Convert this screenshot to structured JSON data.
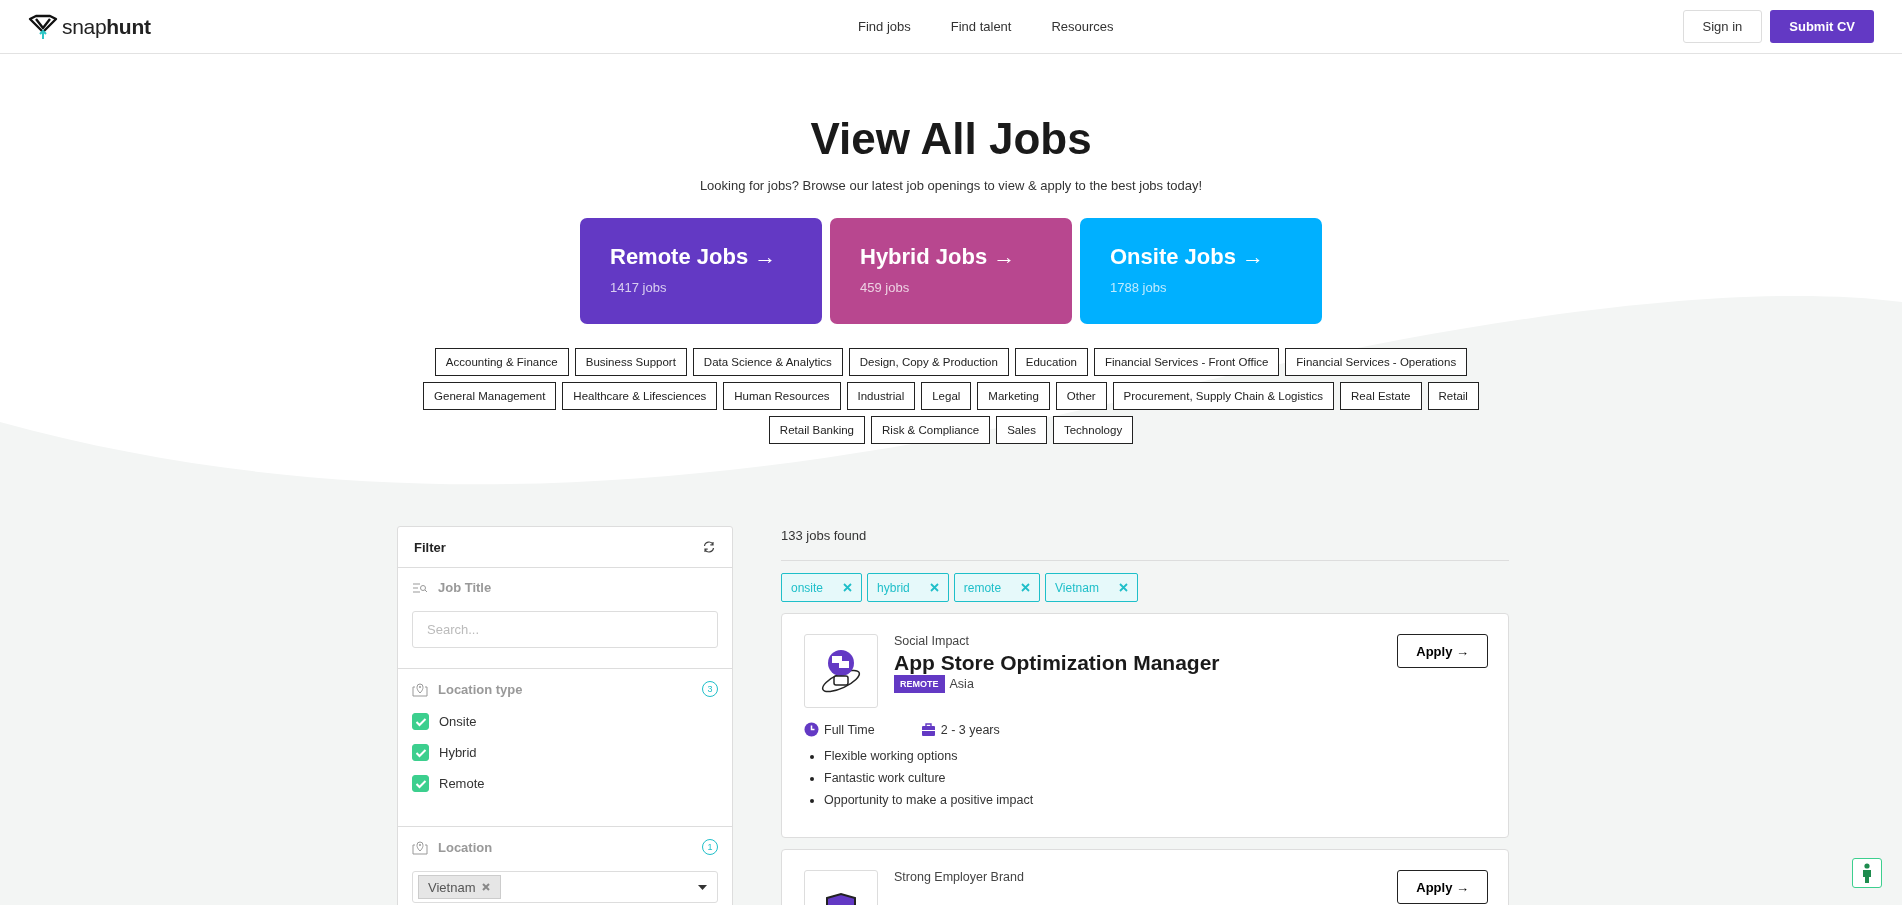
{
  "nav": {
    "logo_light": "snap",
    "logo_bold": "hunt",
    "links": [
      "Find jobs",
      "Find talent",
      "Resources"
    ],
    "sign_in": "Sign in",
    "submit": "Submit CV"
  },
  "hero": {
    "title": "View All Jobs",
    "subtitle": "Looking for jobs? Browse our latest job openings to view & apply to the best jobs today!",
    "type_cards": [
      {
        "kind": "remote",
        "title": "Remote Jobs →",
        "count": "1417 jobs"
      },
      {
        "kind": "hybrid",
        "title": "Hybrid Jobs →",
        "count": "459 jobs"
      },
      {
        "kind": "onsite",
        "title": "Onsite Jobs →",
        "count": "1788 jobs"
      }
    ],
    "category_rows": [
      [
        "Accounting & Finance",
        "Business Support",
        "Data Science & Analytics",
        "Design, Copy & Production",
        "Education",
        "Financial Services - Front Office",
        "Financial Services - Operations"
      ],
      [
        "General Management",
        "Healthcare & Lifesciences",
        "Human Resources",
        "Industrial",
        "Legal",
        "Marketing",
        "Other",
        "Procurement, Supply Chain & Logistics",
        "Real Estate",
        "Retail"
      ],
      [
        "Retail Banking",
        "Risk & Compliance",
        "Sales",
        "Technology"
      ]
    ]
  },
  "filter": {
    "title": "Filter",
    "job_title": {
      "label": "Job Title",
      "placeholder": "Search..."
    },
    "location_type": {
      "label": "Location type",
      "count": "3",
      "options": [
        {
          "label": "Onsite",
          "checked": true
        },
        {
          "label": "Hybrid",
          "checked": true
        },
        {
          "label": "Remote",
          "checked": true
        }
      ]
    },
    "location": {
      "label": "Location",
      "count": "1",
      "chips": [
        "Vietnam"
      ]
    }
  },
  "results": {
    "count": "133 jobs found",
    "active_filters": [
      "onsite",
      "hybrid",
      "remote",
      "Vietnam"
    ],
    "jobs": [
      {
        "category": "Social Impact",
        "title": "App Store Optimization Manager",
        "work_type": "REMOTE",
        "location": "Asia",
        "employment": "Full Time",
        "experience": "2 - 3 years",
        "perks": [
          "Flexible working options",
          "Fantastic work culture",
          "Opportunity to make a positive impact"
        ],
        "apply": "Apply →",
        "kind": "bulb"
      },
      {
        "category": "Strong Employer Brand",
        "apply": "Apply →",
        "kind": "shield"
      }
    ]
  }
}
